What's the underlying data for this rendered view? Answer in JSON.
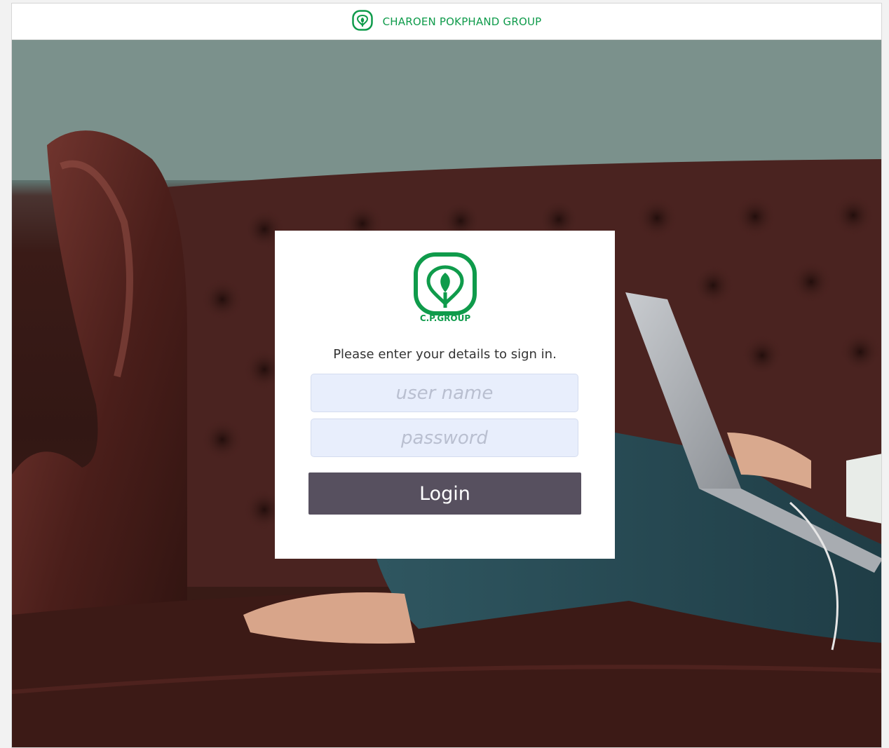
{
  "header": {
    "brand_name": "CHAROEN POKPHAND GROUP",
    "logo_icon": "cp-group-logo-icon"
  },
  "background": {
    "image": "woman-on-leather-sofa-with-laptop-photo"
  },
  "login": {
    "logo_text": "C.P.GROUP",
    "prompt": "Please enter your details to sign in.",
    "username_placeholder": "user name",
    "password_placeholder": "password",
    "button_label": "Login"
  },
  "colors": {
    "brand_green": "#0f9b4b",
    "button": "#57505f",
    "input_bg": "#e8eefc"
  }
}
